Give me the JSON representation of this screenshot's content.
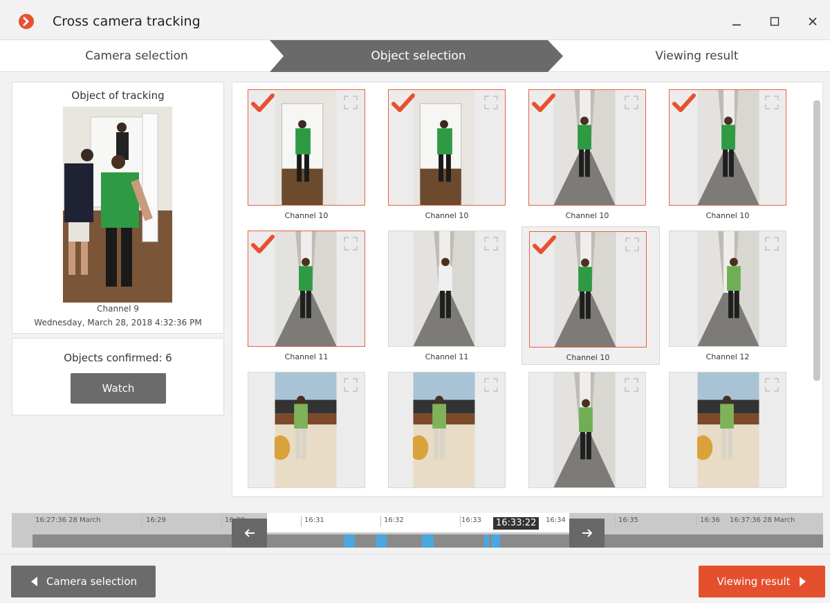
{
  "window": {
    "title": "Cross camera tracking",
    "logo_icon": "chevron-right-circle-icon",
    "controls": [
      "minimize-icon",
      "maximize-icon",
      "close-icon"
    ]
  },
  "steps": {
    "camera_selection": "Camera selection",
    "object_selection": "Object selection",
    "viewing_result": "Viewing result",
    "active": "Object selection"
  },
  "object_panel": {
    "title": "Object of tracking",
    "channel": "Channel 9",
    "datetime": "Wednesday, March 28, 2018 4:32:36 PM"
  },
  "confirm_panel": {
    "confirmed_text": "Objects confirmed: 6",
    "watch_label": "Watch"
  },
  "grid": {
    "items": [
      {
        "channel": "Channel 10",
        "checked": true,
        "scene": "doorway"
      },
      {
        "channel": "Channel 10",
        "checked": true,
        "scene": "doorway"
      },
      {
        "channel": "Channel 10",
        "checked": true,
        "scene": "corridor"
      },
      {
        "channel": "Channel 10",
        "checked": true,
        "scene": "corridor"
      },
      {
        "channel": "Channel 11",
        "checked": true,
        "scene": "corridor"
      },
      {
        "channel": "Channel 11",
        "checked": false,
        "scene": "corridor"
      },
      {
        "channel": "Channel 10",
        "checked": true,
        "scene": "corridor",
        "highlighted": true
      },
      {
        "channel": "Channel 12",
        "checked": false,
        "scene": "corridor"
      },
      {
        "channel": "",
        "checked": false,
        "scene": "office"
      },
      {
        "channel": "",
        "checked": false,
        "scene": "office"
      },
      {
        "channel": "",
        "checked": false,
        "scene": "corridor"
      },
      {
        "channel": "",
        "checked": false,
        "scene": "office"
      }
    ]
  },
  "timeline": {
    "start_label": "16:27:36 28 March",
    "end_label": "16:37:36 28 March",
    "ticks": [
      "16:29",
      "16:30",
      "16:31",
      "16:32",
      "16:33",
      "16:34",
      "16:35",
      "16:36"
    ],
    "current_time": "16:33:22",
    "left_handle_icon": "arrow-left-icon",
    "right_handle_icon": "arrow-right-icon",
    "accent_color": "#4aa8e0"
  },
  "footer": {
    "back_label": "Camera selection",
    "next_label": "Viewing result",
    "next_color": "#e44f2e"
  }
}
